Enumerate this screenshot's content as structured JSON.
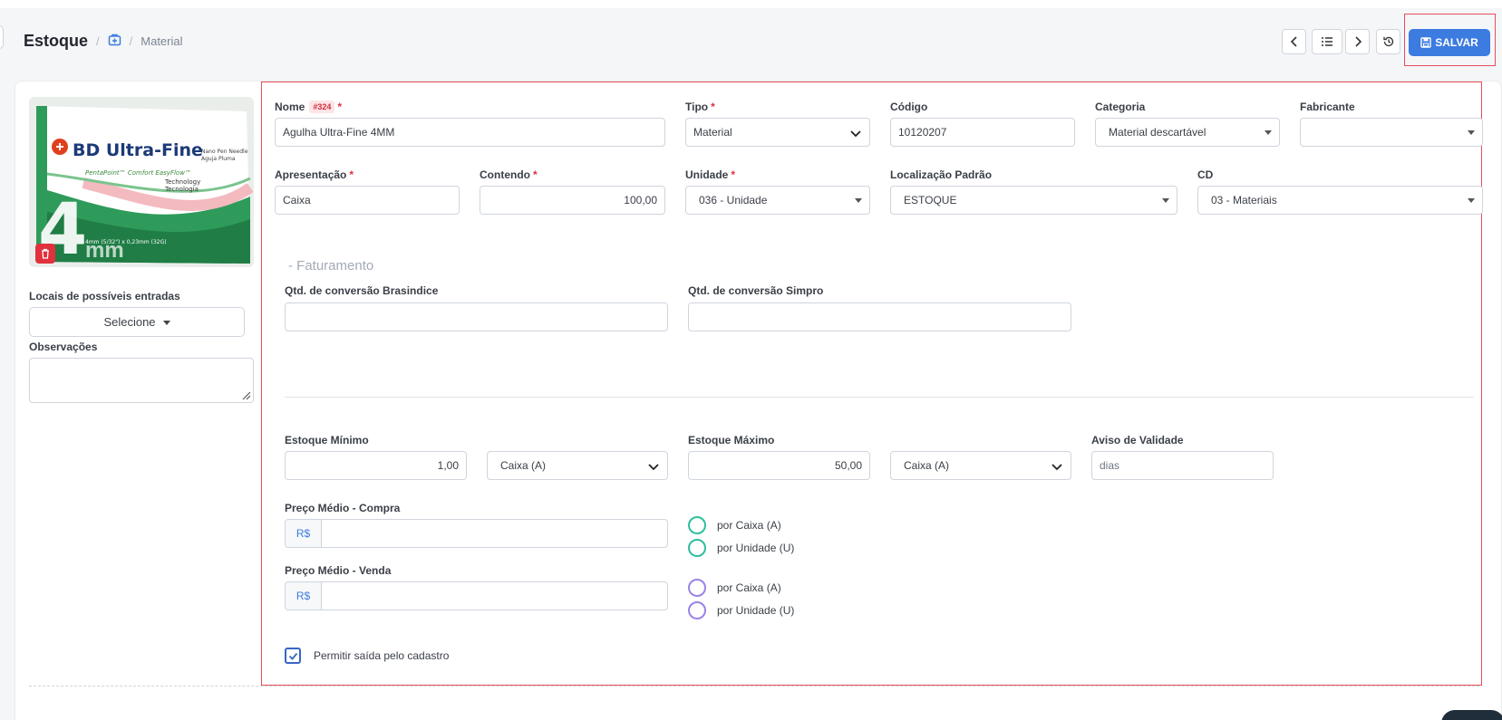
{
  "breadcrumb": {
    "title": "Estoque",
    "separator": "/",
    "current": "Material"
  },
  "toolbar": {
    "save_label": "SALVAR"
  },
  "left": {
    "product_brand": "BD Ultra-Fine",
    "product_size": "4",
    "product_unit": "mm",
    "locais_label": "Locais de possíveis entradas",
    "locais_value": "Selecione",
    "observacoes_label": "Observações"
  },
  "form": {
    "nome_label": "Nome",
    "nome_badge": "#324",
    "nome_value": "Agulha Ultra-Fine 4MM",
    "tipo_label": "Tipo",
    "tipo_value": "Material",
    "codigo_label": "Código",
    "codigo_value": "10120207",
    "categoria_label": "Categoria",
    "categoria_value": "Material descartável",
    "fabricante_label": "Fabricante",
    "fabricante_value": "",
    "apresentacao_label": "Apresentação",
    "apresentacao_value": "Caixa",
    "contendo_label": "Contendo",
    "contendo_value": "100,00",
    "unidade_label": "Unidade",
    "unidade_value": "036 - Unidade",
    "localizacao_label": "Localização Padrão",
    "localizacao_value": "ESTOQUE",
    "cd_label": "CD",
    "cd_value": "03 - Materiais",
    "required_mark": "*",
    "faturamento_title": "- Faturamento",
    "brasindice_label": "Qtd. de conversão Brasindice",
    "simpro_label": "Qtd. de conversão Simpro",
    "estoque_min_label": "Estoque Mínimo",
    "estoque_min_value": "1,00",
    "estoque_min_unit": "Caixa (A)",
    "estoque_max_label": "Estoque Máximo",
    "estoque_max_value": "50,00",
    "estoque_max_unit": "Caixa (A)",
    "aviso_label": "Aviso de Validade",
    "aviso_placeholder": "dias",
    "preco_compra_label": "Preço Médio - Compra",
    "preco_venda_label": "Preço Médio - Venda",
    "currency": "R$",
    "por_caixa": "por Caixa (A)",
    "por_unidade": "por Unidade (U)",
    "permitir_label": "Permitir saída pelo cadastro",
    "permitir_checked": true
  }
}
